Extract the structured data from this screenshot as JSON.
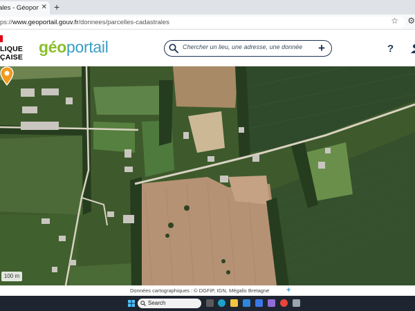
{
  "browser": {
    "tab_title": "ales - Géoportail",
    "tab_close": "✕",
    "new_tab": "+",
    "url_prefix": "ps://",
    "url_host": "www.geoportail.gouv.fr",
    "url_path": "/donnees/parcelles-cadastrales",
    "star_icon": "☆",
    "ext_icon": "⚙"
  },
  "header": {
    "marianne_line1": "LIQUE",
    "marianne_line2": "ÇAISE",
    "logo_geo": "géo",
    "logo_portail": "portail",
    "search_placeholder": "Chercher un lieu, une adresse, une donnée",
    "search_plus": "+",
    "help": "?"
  },
  "map": {
    "scale_label": "100 m"
  },
  "attribution": {
    "text": "Données cartographiques : ©      DGFiP,  IGN,  Mégalis Bretagne",
    "plus": "+"
  },
  "taskbar": {
    "search_label": "Search",
    "apps": [
      "task-view",
      "edge",
      "file-explorer",
      "store",
      "mail",
      "photos",
      "chrome",
      "app"
    ]
  },
  "colors": {
    "accent_dark": "#1d3350",
    "logo_green": "#8bbf2a",
    "logo_blue": "#3a9dc5",
    "marker": "#f39a1e",
    "marianne_red": "#e1000f"
  }
}
